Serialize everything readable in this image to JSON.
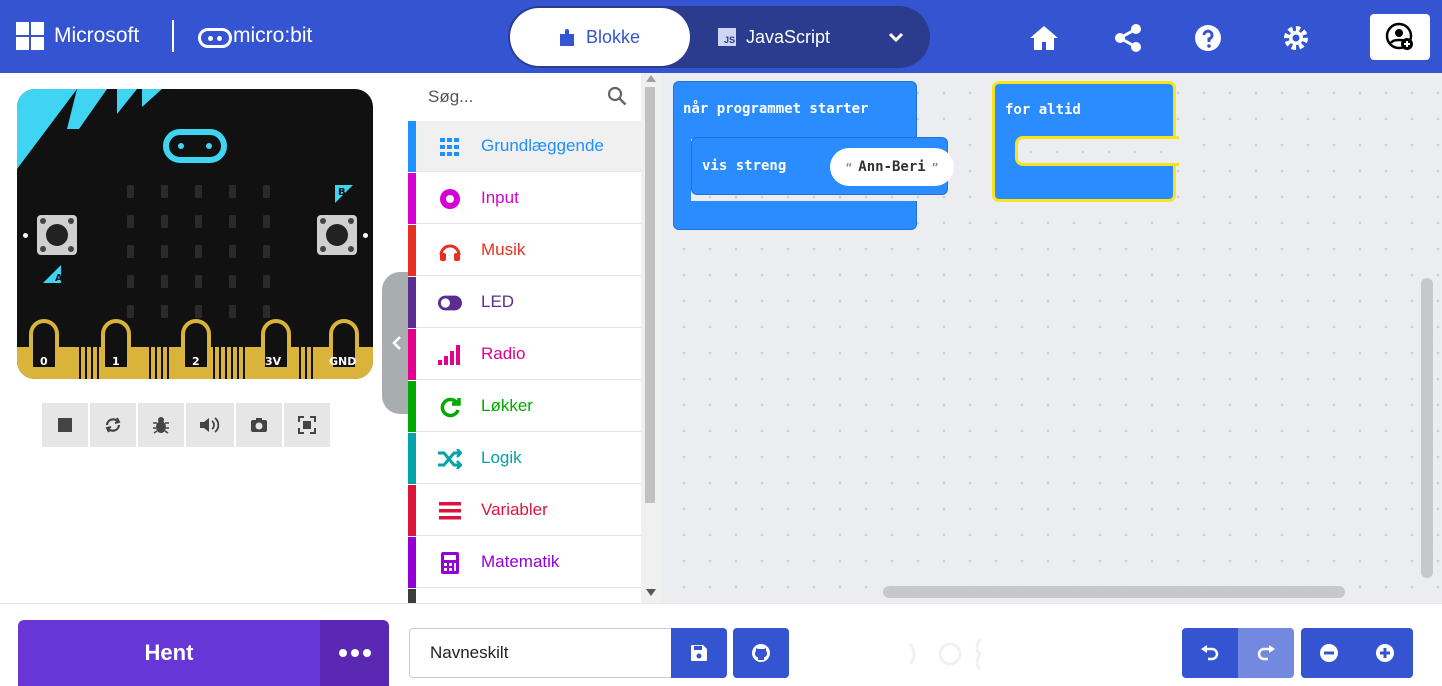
{
  "header": {
    "brand_microsoft": "Microsoft",
    "brand_microbit": "micro:bit",
    "tabs": [
      {
        "label": "Blokke",
        "active": true
      },
      {
        "label": "JavaScript",
        "active": false
      }
    ],
    "js_badge": "JS",
    "icons": [
      "home-icon",
      "share-icon",
      "help-icon",
      "settings-icon",
      "user-icon"
    ],
    "brand_color": "#3454d1"
  },
  "simulator": {
    "pins": [
      "0",
      "1",
      "2",
      "3V",
      "GND"
    ],
    "button_a": "A",
    "button_b": "B",
    "toolbar_icons": [
      "stop-icon",
      "restart-icon",
      "debug-icon",
      "sound-icon",
      "screenshot-icon",
      "fullscreen-icon"
    ]
  },
  "toolbox": {
    "search_placeholder": "Søg...",
    "categories": [
      {
        "label": "Grundlæggende",
        "color": "#1e90ff",
        "icon": "grid-icon",
        "active": true
      },
      {
        "label": "Input",
        "color": "#d400d4",
        "icon": "circle-icon"
      },
      {
        "label": "Musik",
        "color": "#e63022",
        "icon": "headphones-icon"
      },
      {
        "label": "LED",
        "color": "#5c2d91",
        "icon": "toggle-icon"
      },
      {
        "label": "Radio",
        "color": "#e3008c",
        "icon": "signal-icon"
      },
      {
        "label": "Løkker",
        "color": "#00aa00",
        "icon": "loop-icon"
      },
      {
        "label": "Logik",
        "color": "#00a4a6",
        "icon": "shuffle-icon"
      },
      {
        "label": "Variabler",
        "color": "#dc143c",
        "icon": "list-icon"
      },
      {
        "label": "Matematik",
        "color": "#9400d3",
        "icon": "calculator-icon"
      }
    ]
  },
  "workspace": {
    "block_on_start": "når programmet starter",
    "block_show_string": "vis streng",
    "string_value": "Ann-Beri",
    "block_forever": "for altid"
  },
  "bottom": {
    "download_label": "Hent",
    "project_name": "Navneskilt"
  }
}
